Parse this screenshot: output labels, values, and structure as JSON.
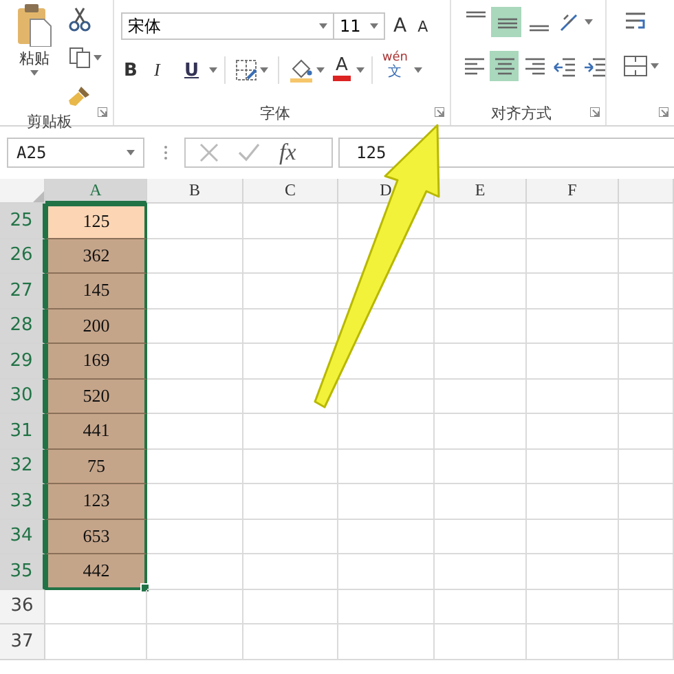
{
  "ribbon": {
    "clipboard": {
      "paste_label": "粘贴",
      "group_label": "剪贴板"
    },
    "font": {
      "font_name": "宋体",
      "font_size": "11",
      "grow_font": "A",
      "shrink_font": "A",
      "bold": "B",
      "italic": "I",
      "underline": "U",
      "font_color": "A",
      "phonetic_top": "wén",
      "phonetic_bottom": "文",
      "group_label": "字体"
    },
    "alignment": {
      "group_label": "对齐方式",
      "top_row": [
        {
          "kind": "top",
          "selected": false
        },
        {
          "kind": "middle",
          "selected": true
        },
        {
          "kind": "bottom",
          "selected": false
        },
        {
          "kind": "orientation",
          "selected": false
        }
      ],
      "bottom_row": [
        {
          "kind": "left",
          "selected": false
        },
        {
          "kind": "center",
          "selected": true
        },
        {
          "kind": "right",
          "selected": false
        },
        {
          "kind": "outdent",
          "selected": false
        },
        {
          "kind": "indent",
          "selected": false
        }
      ]
    }
  },
  "formula_bar": {
    "name_box": "A25",
    "fx": "fx",
    "formula": "125"
  },
  "sheet": {
    "columns": [
      {
        "label": "A",
        "selected": true
      },
      {
        "label": "B",
        "selected": false
      },
      {
        "label": "C",
        "selected": false
      },
      {
        "label": "D",
        "selected": false
      },
      {
        "label": "E",
        "selected": false
      },
      {
        "label": "F",
        "selected": false
      }
    ],
    "rows": [
      {
        "number": "25",
        "a": "125",
        "selected": true,
        "active": true
      },
      {
        "number": "26",
        "a": "362",
        "selected": true,
        "active": false
      },
      {
        "number": "27",
        "a": "145",
        "selected": true,
        "active": false
      },
      {
        "number": "28",
        "a": "200",
        "selected": true,
        "active": false
      },
      {
        "number": "29",
        "a": "169",
        "selected": true,
        "active": false
      },
      {
        "number": "30",
        "a": "520",
        "selected": true,
        "active": false
      },
      {
        "number": "31",
        "a": "441",
        "selected": true,
        "active": false
      },
      {
        "number": "32",
        "a": "75",
        "selected": true,
        "active": false
      },
      {
        "number": "33",
        "a": "123",
        "selected": true,
        "active": false
      },
      {
        "number": "34",
        "a": "653",
        "selected": true,
        "active": false
      },
      {
        "number": "35",
        "a": "442",
        "selected": true,
        "active": false
      },
      {
        "number": "36",
        "selected": false,
        "active": false
      },
      {
        "number": "37",
        "selected": false,
        "active": false
      }
    ]
  }
}
